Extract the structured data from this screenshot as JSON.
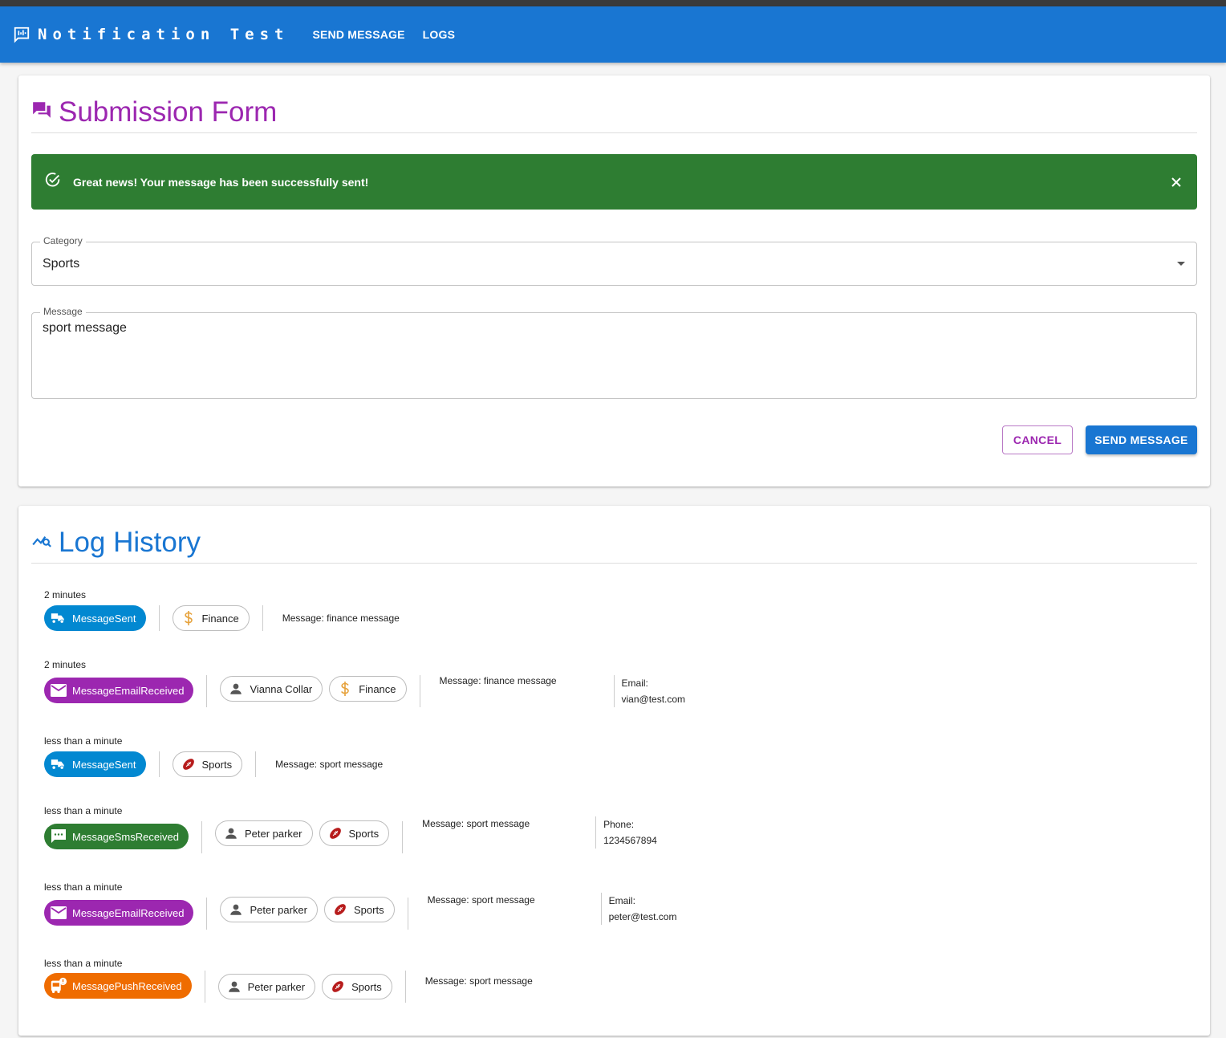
{
  "app": {
    "title": "Notification Test",
    "nav": [
      "SEND MESSAGE",
      "LOGS"
    ],
    "primary_color": "#1976d2"
  },
  "form": {
    "title": "Submission Form",
    "alert": {
      "text": "Great news! Your message has been successfully sent!",
      "color": "#2e7d32"
    },
    "category": {
      "label": "Category",
      "value": "Sports"
    },
    "message": {
      "label": "Message",
      "value": "sport message"
    },
    "cancel_label": "CANCEL",
    "send_label": "SEND MESSAGE"
  },
  "logs": {
    "title": "Log History",
    "entries": [
      {
        "time": "2 minutes",
        "event": "MessageSent",
        "event_icon": "delivery-icon",
        "event_color": "#0288d1",
        "user": "",
        "category": "Finance",
        "category_icon": "dollar-icon",
        "message": "Message: finance message",
        "contact_label": "",
        "contact_value": ""
      },
      {
        "time": "2 minutes",
        "event": "MessageEmailReceived",
        "event_icon": "email-icon",
        "event_color": "#9c27b0",
        "user": "Vianna Collar",
        "category": "Finance",
        "category_icon": "dollar-icon",
        "message": "Message: finance message",
        "contact_label": "Email:",
        "contact_value": "vian@test.com"
      },
      {
        "time": "less than a minute",
        "event": "MessageSent",
        "event_icon": "delivery-icon",
        "event_color": "#0288d1",
        "user": "",
        "category": "Sports",
        "category_icon": "football-icon",
        "message": "Message: sport message",
        "contact_label": "",
        "contact_value": ""
      },
      {
        "time": "less than a minute",
        "event": "MessageSmsReceived",
        "event_icon": "sms-icon",
        "event_color": "#2e7d32",
        "user": "Peter parker",
        "category": "Sports",
        "category_icon": "football-icon",
        "message": "Message: sport message",
        "contact_label": "Phone:",
        "contact_value": "1234567894"
      },
      {
        "time": "less than a minute",
        "event": "MessageEmailReceived",
        "event_icon": "email-icon",
        "event_color": "#9c27b0",
        "user": "Peter parker",
        "category": "Sports",
        "category_icon": "football-icon",
        "message": "Message: sport message",
        "contact_label": "Email:",
        "contact_value": "peter@test.com"
      },
      {
        "time": "less than a minute",
        "event": "MessagePushReceived",
        "event_icon": "push-notification-icon",
        "event_color": "#ef6c00",
        "user": "Peter parker",
        "category": "Sports",
        "category_icon": "football-icon",
        "message": "Message: sport message",
        "contact_label": "",
        "contact_value": ""
      }
    ]
  }
}
